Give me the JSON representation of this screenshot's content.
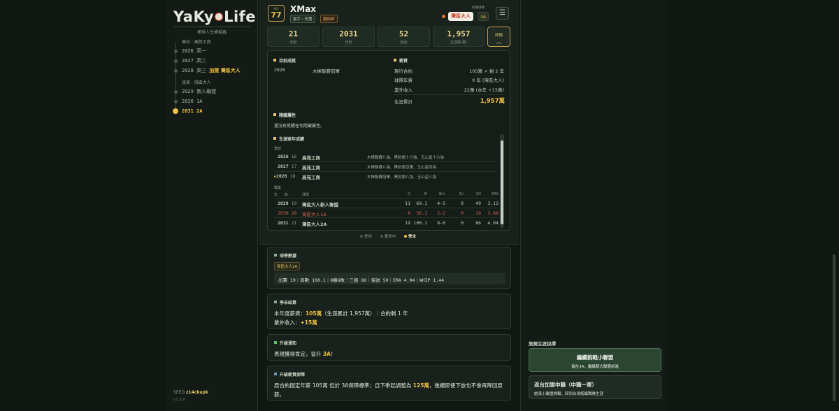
{
  "sidebar": {
    "logo_left": "YaKy",
    "logo_right": "Life",
    "subtitle": "棒球人生模擬器",
    "sections": [
      {
        "label": "高中 · 高苑工商",
        "items": [
          {
            "text": "2026 高一"
          },
          {
            "text": "2027 高二"
          },
          {
            "text": "2028 高三",
            "hl": "加盟 灣區大人"
          }
        ]
      },
      {
        "label": "旅美 · 灣區大人",
        "items": [
          {
            "text": "2029 新人聯盟"
          },
          {
            "text": "2030 1A"
          },
          {
            "text": "2031 2A",
            "current": true
          }
        ]
      }
    ],
    "seed_label": "SEED",
    "seed_value": "z14ckupk",
    "version": "v1.5.0"
  },
  "header": {
    "no_label": "NO.",
    "number": "77",
    "name": "XMax",
    "tag_position": "投手・先發",
    "tag_type": "魔術師",
    "team_label": "所屬球隊",
    "team": "灣區大人",
    "level": "3A",
    "menu_icon": "hamburger-icon"
  },
  "stats": [
    {
      "value": "21",
      "label": "年齡"
    },
    {
      "value": "2031",
      "label": "年份"
    },
    {
      "value": "52",
      "label": "綜合"
    },
    {
      "value": "1,957",
      "label": "生涯薪(萬)"
    }
  ],
  "detail_btn": "詳情",
  "record": {
    "title": "目前成就",
    "year": "2028",
    "text": "木棒聯賽冠軍"
  },
  "salary": {
    "title": "薪資",
    "rows": [
      {
        "label": "現行合約",
        "value": "105萬 × 剩 2 年"
      },
      {
        "label": "球隊年資",
        "value": "0 年 (灣區大人)"
      },
      {
        "label": "業外收入",
        "value": "22萬 (本年 +15萬)"
      }
    ],
    "total_label": "生涯累計",
    "total_value": "1,957萬"
  },
  "hidden": {
    "title": "隱藏屬性",
    "text": "還沒有覺醒任何隱藏屬性。"
  },
  "career": {
    "title": "生涯逐年成績",
    "amateur_label": "業餘",
    "amateur": [
      {
        "year": "2026",
        "age": "16",
        "team": "高苑工商",
        "note": "木棒聯賽八強、黑豹旗十六強、玉山盃十六強"
      },
      {
        "year": "2027",
        "age": "17",
        "team": "高苑工商",
        "note": "木棒聯賽八強、黑豹旗亞軍、玉山盃四強"
      },
      {
        "year": "2028",
        "age": "18",
        "team": "高苑工商",
        "note": "木棒聯賽冠軍、黑豹旗八強、玉山盃八強",
        "star": "★"
      }
    ],
    "pro_label": "職業",
    "pro_headers": {
      "year": "年",
      "age": "齡",
      "team": "球隊",
      "g": "G",
      "ip": "IP",
      "wl": "W-L",
      "sv": "SV",
      "so": "SO",
      "era": "ERA"
    },
    "pro": [
      {
        "year": "2029",
        "age": "19",
        "team": "灣區大人新人聯盟",
        "g": "11",
        "ip": "69.1",
        "wl": "4-5",
        "sv": "0",
        "so": "49",
        "era": "3.12"
      },
      {
        "year": "2030",
        "age": "20",
        "team": "灣區大人1A",
        "g": "6",
        "ip": "36.1",
        "wl": "2-2",
        "sv": "0",
        "so": "19",
        "era": "3.86",
        "red": true
      },
      {
        "year": "2031",
        "age": "21",
        "team": "灣區大人2A",
        "g": "19",
        "ip": "100.1",
        "wl": "8-6",
        "sv": "0",
        "so": "86",
        "era": "4.04"
      }
    ]
  },
  "season_phase": {
    "items": [
      "季初",
      "賽季中",
      "季末"
    ],
    "active": 2
  },
  "season_stats": {
    "title": "球季數據",
    "team": "灣區大人2A",
    "line": "出賽 19｜局數 100.1｜8勝6敗｜三振 86｜保送 50｜ERA 4.04｜WHIP 1.44"
  },
  "season_end": {
    "title": "季末結算",
    "line1_pre": "本年度薪資：",
    "line1_val": "105萬",
    "line1_post": "（生涯累計 1,957萬）｜合約剩 1 年",
    "line2_pre": "業外收入：",
    "line2_val": "+15萬"
  },
  "promotion": {
    "title": "升級通知",
    "pre": "表現獲得肯定，晉升 ",
    "val": "3A",
    "post": "！"
  },
  "salary_guarantee": {
    "title": "升級薪資保障",
    "pre": "原合約固定年薪 105萬 低於 3A保障標準；自下季起調整為 ",
    "val": "125萬",
    "post": "，後續即使下放也不會再降回原薪。"
  },
  "choices": {
    "title": "旅美生涯抉擇",
    "a_title": "繼續挑戰小聯盟",
    "a_sub": "留在3A，繼續朝大聯盟前進",
    "b_title": "返台加盟中職（中職一軍）",
    "b_sub": "結束小聯盟挑戰，回到台灣諾編職業生涯"
  },
  "colors": {
    "accent": "#f0c040",
    "team": "#c9452d",
    "bg": "#101612"
  }
}
